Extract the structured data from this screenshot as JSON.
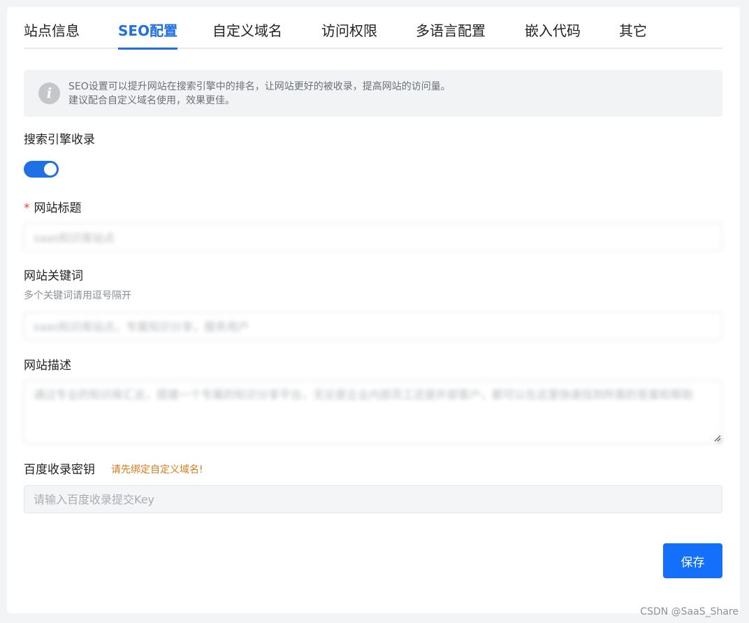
{
  "tabs": [
    {
      "label": "站点信息",
      "active": false
    },
    {
      "label": "SEO配置",
      "active": true
    },
    {
      "label": "自定义域名",
      "active": false
    },
    {
      "label": "访问权限",
      "active": false
    },
    {
      "label": "多语言配置",
      "active": false
    },
    {
      "label": "嵌入代码",
      "active": false
    },
    {
      "label": "其它",
      "active": false
    }
  ],
  "notice": {
    "icon": "info-icon",
    "line1": "SEO设置可以提升网站在搜索引擎中的排名，让网站更好的被收录，提高网站的访问量。",
    "line2": "建议配合自定义域名使用，效果更佳。"
  },
  "form": {
    "indexing": {
      "label": "搜索引擎收录",
      "enabled": true
    },
    "site_title": {
      "required_mark": "*",
      "label": "网站标题",
      "value": "saas知识库站点"
    },
    "keywords": {
      "label": "网站关键词",
      "hint": "多个关键词请用逗号隔开",
      "value": "saas知识库站点，专属知识分享，服务用户"
    },
    "description": {
      "label": "网站描述",
      "value": "通过专业的知识库汇总，搭建一个专属的知识分享平台，无论是企业内部员工还是外部客户，都可以在这里快速找到所需的答案和帮助"
    },
    "baidu_key": {
      "label": "百度收录密钥",
      "warning": "请先绑定自定义域名!",
      "placeholder": "请输入百度收录提交Key",
      "disabled": true
    }
  },
  "actions": {
    "save_label": "保存"
  },
  "colors": {
    "accent": "#1f6fe5",
    "button": "#1470fa",
    "warning": "#d97b17",
    "required": "#e5483a"
  },
  "watermark": "CSDN @SaaS_Share"
}
